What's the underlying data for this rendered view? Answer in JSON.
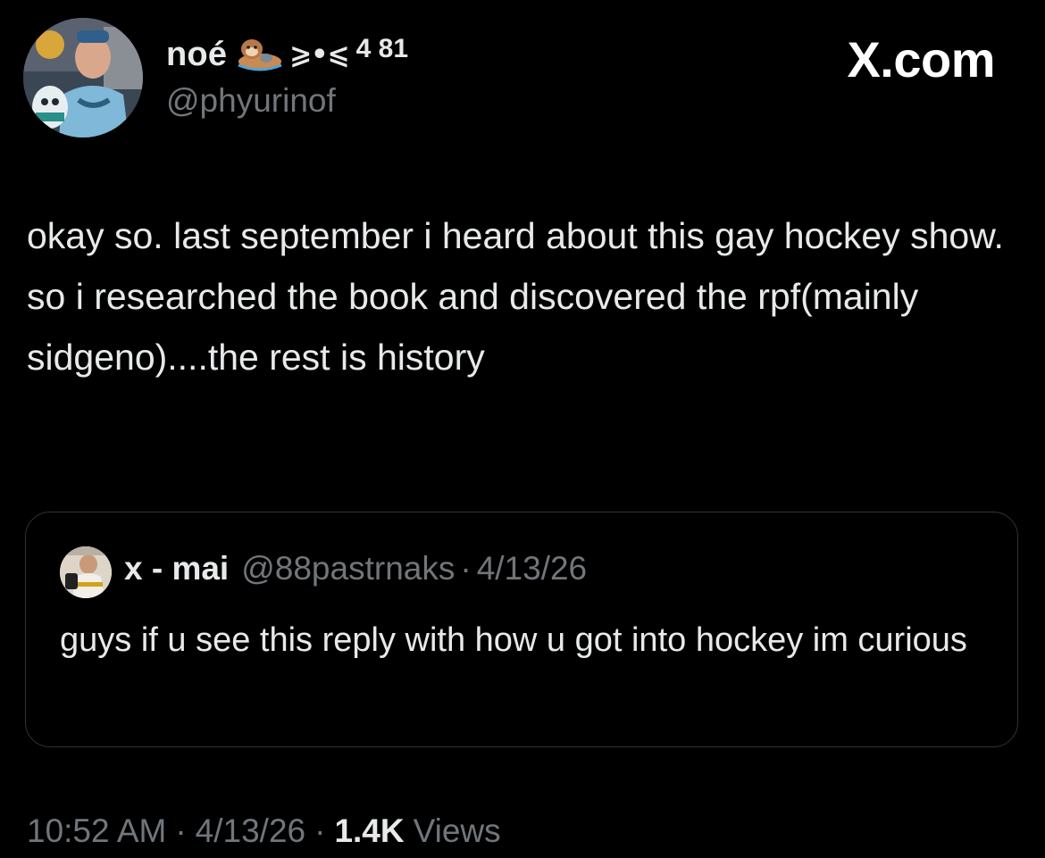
{
  "author": {
    "display_name": "noé",
    "name_emoji_icon": "otter-icon",
    "name_emoticon": "⩾•⩽",
    "name_number": "4 81",
    "handle": "@phyurinof"
  },
  "watermark": "X.com",
  "tweet": {
    "text": "okay so. last september i heard about this gay hockey show. so i researched the book and discovered the rpf(mainly sidgeno)....the rest is history"
  },
  "quoted_tweet": {
    "display_name": "x - mai",
    "handle": "@88pastrnaks",
    "separator": "·",
    "date": "4/13/26",
    "text": "guys if u see this reply with how u got into hockey im curious"
  },
  "meta": {
    "time": "10:52 AM",
    "separator": "·",
    "date": "4/13/26",
    "views_count": "1.4K",
    "views_label": "Views"
  },
  "colors": {
    "background": "#000000",
    "text_primary": "#e7e9ea",
    "text_secondary": "#71767b",
    "border": "#2f3336"
  }
}
